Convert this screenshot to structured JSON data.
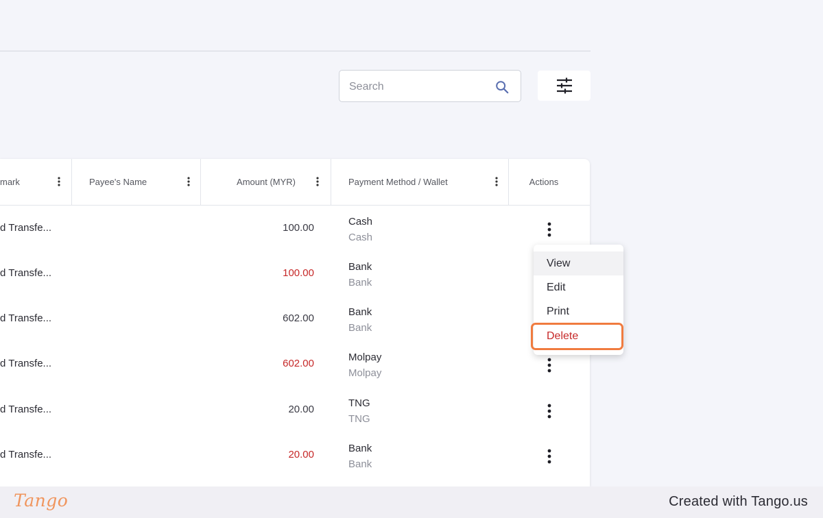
{
  "search": {
    "placeholder": "Search"
  },
  "columns": [
    {
      "label": "mark"
    },
    {
      "label": "Payee's Name"
    },
    {
      "label": "Amount (MYR)"
    },
    {
      "label": "Payment Method / Wallet"
    },
    {
      "label": "Actions"
    }
  ],
  "rows": [
    {
      "remark": "d Transfe...",
      "amount": "100.00",
      "negative": false,
      "method": "Cash",
      "wallet": "Cash"
    },
    {
      "remark": "d Transfe...",
      "amount": "100.00",
      "negative": true,
      "method": "Bank",
      "wallet": "Bank"
    },
    {
      "remark": "d Transfe...",
      "amount": "602.00",
      "negative": false,
      "method": "Bank",
      "wallet": "Bank"
    },
    {
      "remark": "d Transfe...",
      "amount": "602.00",
      "negative": true,
      "method": "Molpay",
      "wallet": "Molpay"
    },
    {
      "remark": "d Transfe...",
      "amount": "20.00",
      "negative": false,
      "method": "TNG",
      "wallet": "TNG"
    },
    {
      "remark": "d Transfe...",
      "amount": "20.00",
      "negative": true,
      "method": "Bank",
      "wallet": "Bank"
    }
  ],
  "actions_menu": {
    "items": [
      "View",
      "Edit",
      "Print",
      "Delete"
    ],
    "hovered": "View",
    "highlighted": "Delete"
  },
  "colors": {
    "negative_amount": "#c62828",
    "highlight_outline": "#f07b3f",
    "brand": "#f0955d"
  },
  "footer": {
    "logo": "Tango",
    "credit": "Created with Tango.us"
  },
  "icons": [
    "search-icon",
    "filter-sliders-icon",
    "column-menu-icon",
    "kebab-menu-icon"
  ]
}
